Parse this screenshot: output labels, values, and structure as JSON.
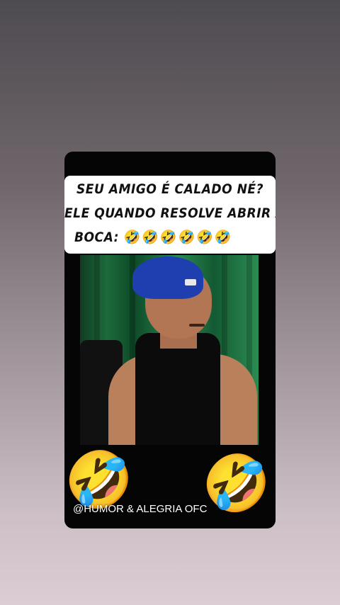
{
  "caption": {
    "line1": "SEU AMIGO É CALADO NÉ?",
    "line2": "ELE QUANDO RESOLVE ABRIR A",
    "line3_text": "BOCA:",
    "line3_emojis": "🤣🤣🤣🤣🤣🤣"
  },
  "video": {
    "subject": "video-frame"
  },
  "decorations": {
    "left_emoji": "🤣",
    "right_emoji": "🤣"
  },
  "watermark": "@HUMOR & ALEGRIA OFC",
  "colors": {
    "card_background": "#050505",
    "caption_background": "#ffffff",
    "cap_blue": "#1f3fb0",
    "curtain_green": "#1e6a3b"
  }
}
